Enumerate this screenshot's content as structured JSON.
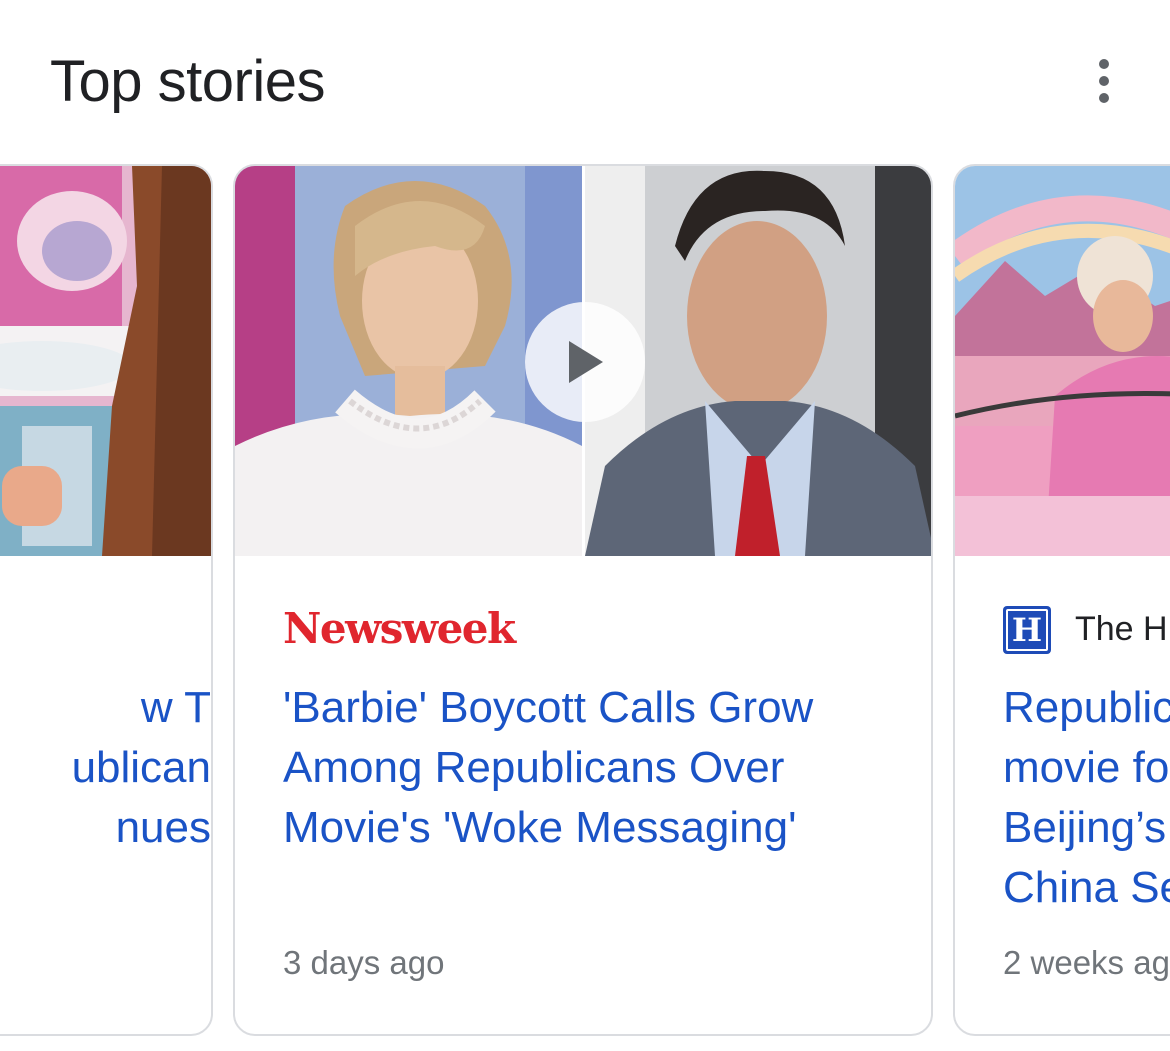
{
  "header": {
    "title": "Top stories",
    "more_icon": "more-vert-icon"
  },
  "stories": [
    {
      "headline_lines": [
        "w T",
        "ublican",
        "nues"
      ]
    },
    {
      "source": "Newsweek",
      "headline_lines": [
        "'Barbie' Boycott Calls Grow",
        "Among Republicans Over",
        "Movie's 'Woke Messaging'"
      ],
      "time": "3 days ago",
      "has_video": true,
      "play_icon": "play-icon"
    },
    {
      "source_logo_letter": "H",
      "source": "The H",
      "headline_lines": [
        "Republic",
        "movie fo",
        "Beijing’s",
        "China Se"
      ],
      "time": "2 weeks ag"
    }
  ],
  "colors": {
    "headline": "#1a53c6",
    "newsweek_red": "#e0262e",
    "muted": "#70757a",
    "border": "#dadce0"
  }
}
